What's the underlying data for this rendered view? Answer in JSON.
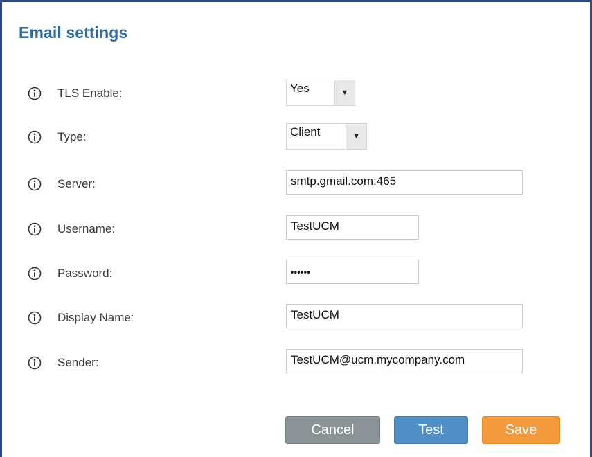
{
  "panel": {
    "title": "Email settings"
  },
  "fields": [
    {
      "label": "TLS Enable:",
      "kind": "select",
      "value": "Yes"
    },
    {
      "label": "Type:",
      "kind": "select",
      "value": "Client"
    },
    {
      "label": "Server:",
      "kind": "text",
      "value": "smtp.gmail.com:465"
    },
    {
      "label": "Username:",
      "kind": "text",
      "value": "TestUCM"
    },
    {
      "label": "Password:",
      "kind": "password",
      "value": "••••••"
    },
    {
      "label": "Display Name:",
      "kind": "text",
      "value": "TestUCM"
    },
    {
      "label": "Sender:",
      "kind": "text",
      "value": "TestUCM@ucm.mycompany.com"
    }
  ],
  "buttons": {
    "cancel": "Cancel",
    "test": "Test",
    "save": "Save"
  },
  "icons": {
    "info": "info-icon",
    "dropdown": "dropdown-arrow-icon"
  },
  "colors": {
    "frame_border": "#2e4a7d",
    "title": "#2f6c9f",
    "cancel_button": "#8c9396",
    "test_button": "#4f8ec6",
    "save_button": "#f39a3c"
  }
}
